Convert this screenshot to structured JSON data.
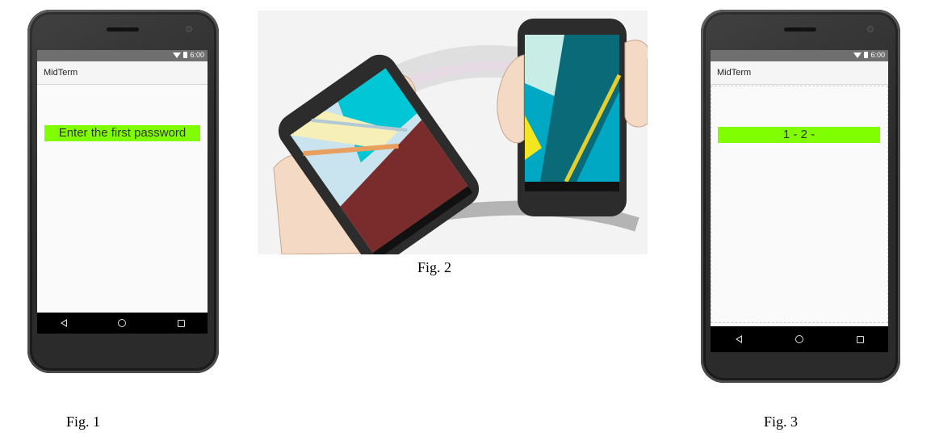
{
  "fig1": {
    "caption": "Fig. 1",
    "status_time": "6:00",
    "app_title": "MidTerm",
    "prompt_text": "Enter the first password"
  },
  "fig2": {
    "caption": "Fig. 2"
  },
  "fig3": {
    "caption": "Fig. 3",
    "status_time": "6:00",
    "app_title": "MidTerm",
    "password_display": "1 - 2 -"
  },
  "icons": {
    "status": [
      "wifi-icon",
      "battery-icon"
    ],
    "nav": [
      "back-icon",
      "home-icon",
      "recents-icon"
    ]
  },
  "colors": {
    "highlight": "#7fff00",
    "status_bar": "#6f6f6f",
    "nav_bar": "#000000",
    "phone_body": "#2b2b2b"
  }
}
